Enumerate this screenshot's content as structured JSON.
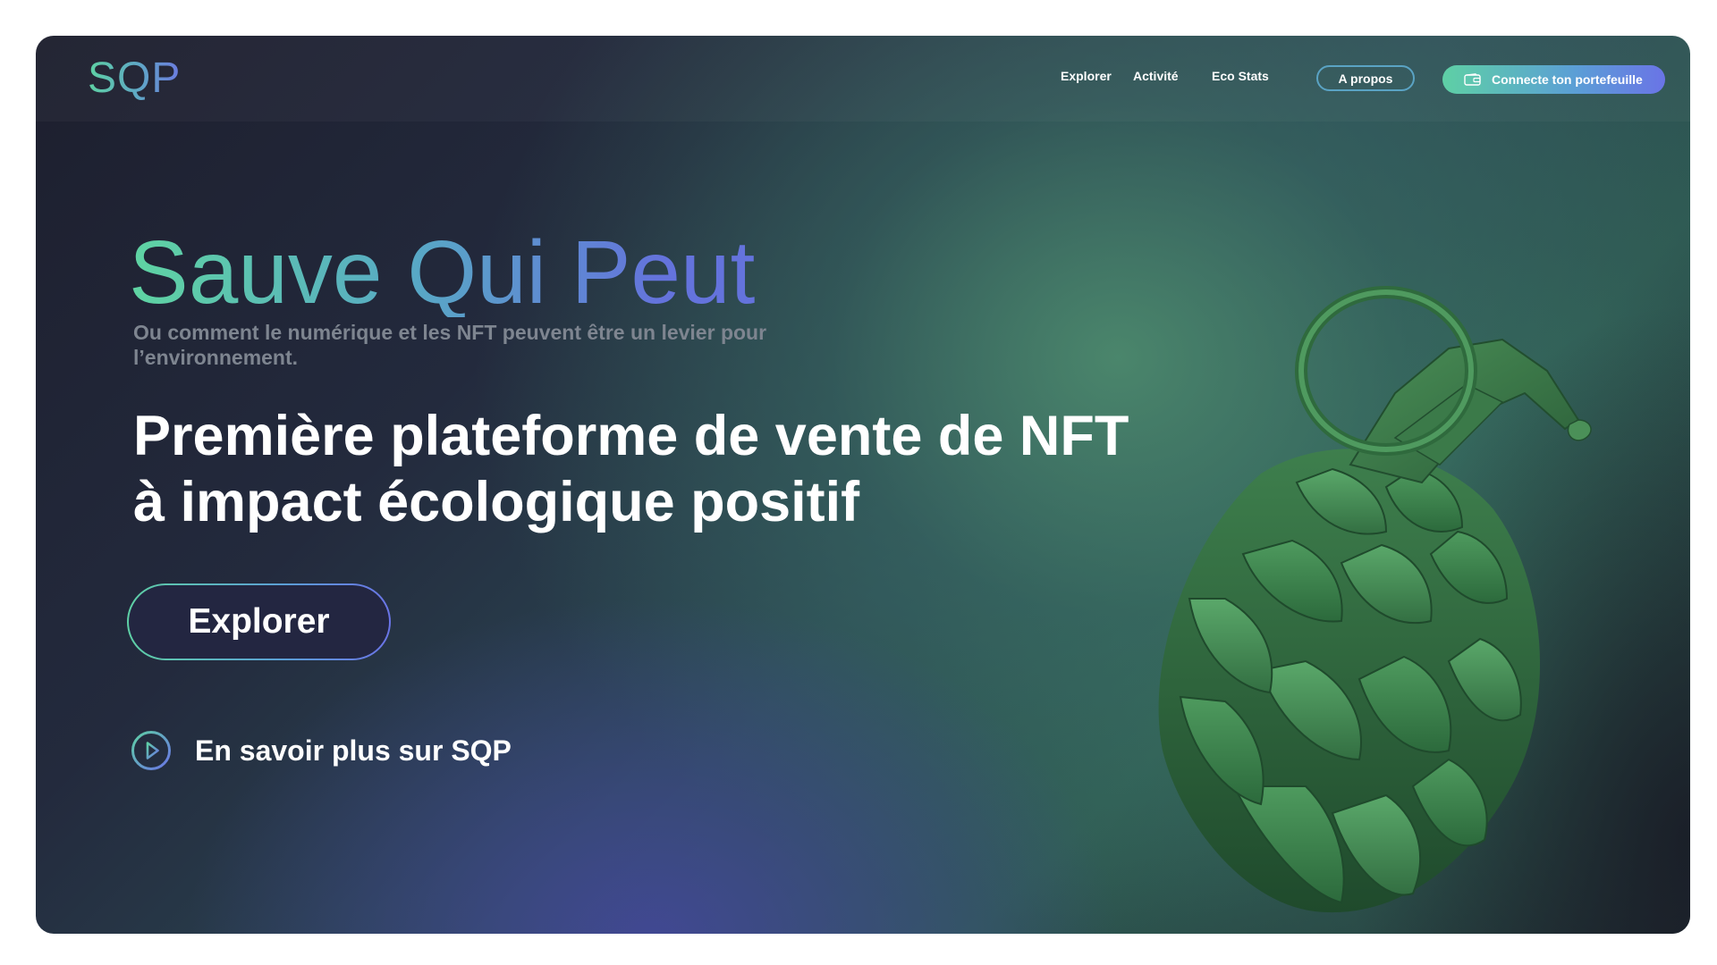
{
  "nav": {
    "logo": "SQP",
    "links": [
      "Explorer",
      "Activité",
      "Eco Stats"
    ],
    "about": "A propos",
    "wallet_button": "Connecte ton portefeuille"
  },
  "hero": {
    "title": "Sauve Qui Peut",
    "subtitle": "Ou comment le numérique et les NFT peuvent être un levier pour l’environnement.",
    "headline_line1": "Première plateforme de vente de NFT",
    "headline_line2": "à impact écologique positif",
    "explore_button": "Explorer",
    "learn_more": "En savoir plus sur SQP"
  },
  "colors": {
    "accent_green": "#5ed0a5",
    "accent_blue": "#6a74e6",
    "background_dark": "#1d1f2e"
  },
  "icons": {
    "wallet": "wallet-icon",
    "play": "play-circle-icon",
    "hero_image": "artichoke-grenade-illustration"
  }
}
